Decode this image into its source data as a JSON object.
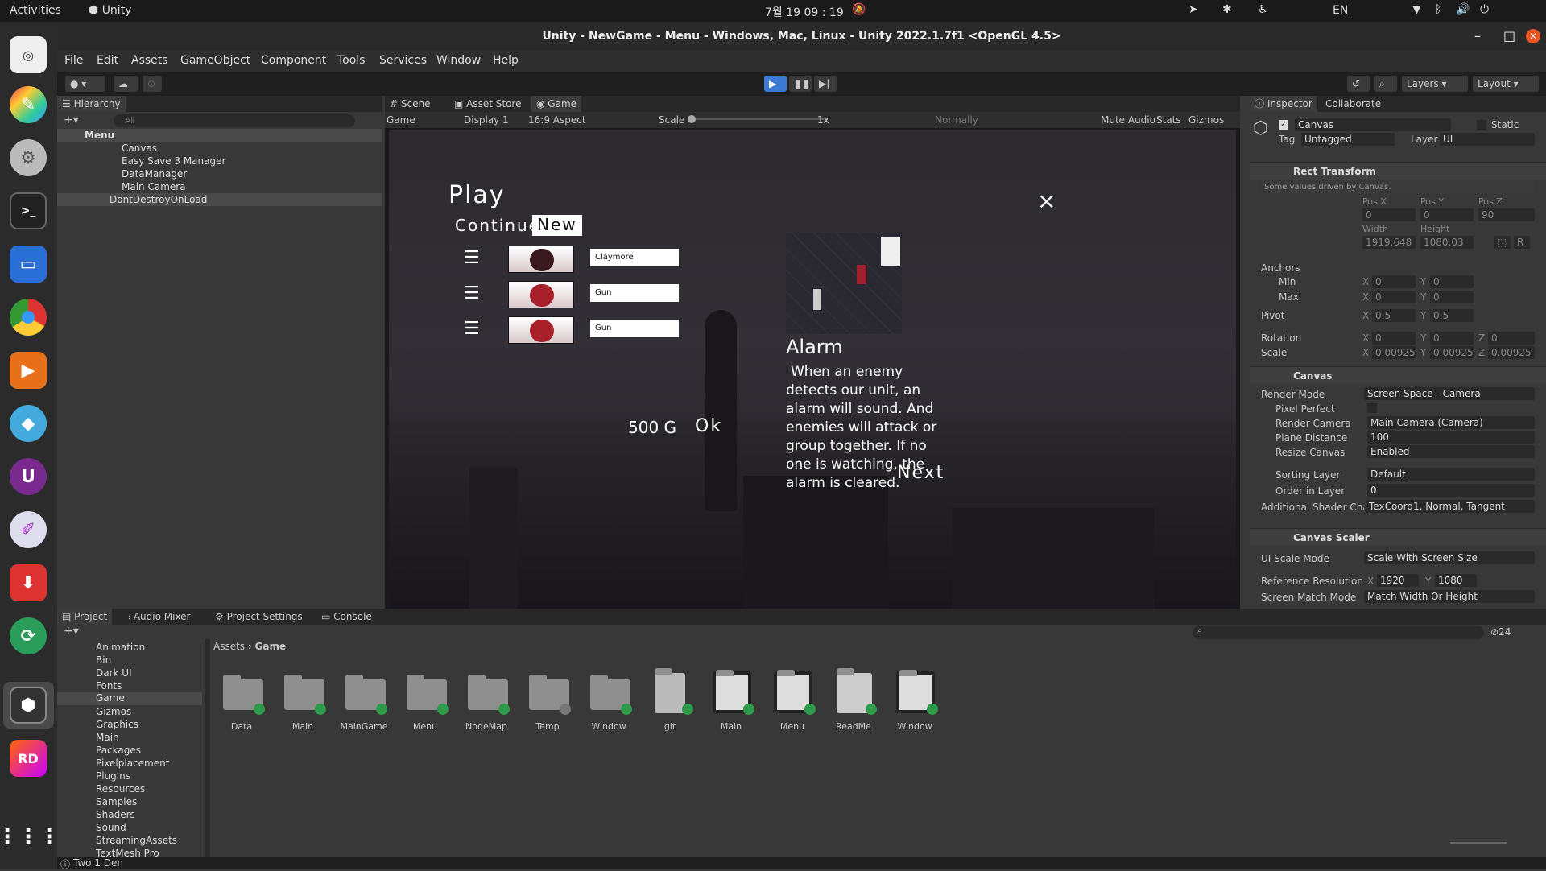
{
  "system": {
    "activities": "Activities",
    "app": "Unity",
    "clock": "7월 19  09 : 19",
    "lang": "EN"
  },
  "window": {
    "title": "Unity - NewGame - Menu - Windows, Mac, Linux - Unity 2022.1.7f1 <OpenGL 4.5>"
  },
  "menu": [
    "File",
    "Edit",
    "Assets",
    "GameObject",
    "Component",
    "Tools",
    "Services",
    "Window",
    "Help"
  ],
  "toolbar": {
    "layers": "Layers",
    "layout": "Layout"
  },
  "hierarchy": {
    "tab": "Hierarchy",
    "search_placeholder": "All",
    "items": [
      "Menu",
      "Canvas",
      "Easy Save 3 Manager",
      "DataManager",
      "Main Camera",
      "DontDestroyOnLoad"
    ]
  },
  "scene_tabs": [
    "Scene",
    "Asset Store",
    "Game"
  ],
  "gamebar": {
    "mode": "Game",
    "display": "Display 1",
    "aspect": "16:9 Aspect",
    "scale_label": "Scale",
    "scale_value": "1x",
    "normally": "Normally",
    "mute": "Mute Audio",
    "stats": "Stats",
    "gizmos": "Gizmos"
  },
  "game": {
    "play": "Play",
    "continue": "Continue",
    "new": "New",
    "slots": [
      "Claymore",
      "Gun",
      "Gun"
    ],
    "gold": "500 G",
    "ok": "Ok",
    "alarm_title": "Alarm",
    "alarm_text": "When an enemy detects our unit, an alarm will sound. And enemies will attack or group together. If no one is watching, the alarm is cleared.",
    "next": "Next",
    "close": "×"
  },
  "inspector": {
    "tabs": [
      "Inspector",
      "Collaborate"
    ],
    "name": "Canvas",
    "static": "Static",
    "tag_label": "Tag",
    "tag": "Untagged",
    "layer_label": "Layer",
    "layer": "UI",
    "rect": {
      "title": "Rect Transform",
      "note": "Some values driven by Canvas.",
      "posx_l": "Pos X",
      "posy_l": "Pos Y",
      "posz_l": "Pos Z",
      "posx": "0",
      "posy": "0",
      "posz": "90",
      "w_l": "Width",
      "h_l": "Height",
      "w": "1919.648",
      "h": "1080.03",
      "anchors": "Anchors",
      "min": "Min",
      "max": "Max",
      "pivot": "Pivot",
      "rotation": "Rotation",
      "scale": "Scale",
      "zero": "0",
      "half": "0.5",
      "sc": "0.00925",
      "x": "X",
      "y": "Y",
      "z": "Z",
      "r": "R"
    },
    "canvas": {
      "title": "Canvas",
      "render_mode_l": "Render Mode",
      "render_mode": "Screen Space - Camera",
      "pixel_perfect": "Pixel Perfect",
      "render_cam_l": "Render Camera",
      "render_cam": "Main Camera (Camera)",
      "plane_l": "Plane Distance",
      "plane": "100",
      "resize_l": "Resize Canvas",
      "resize": "Enabled",
      "sorting_l": "Sorting Layer",
      "sorting": "Default",
      "order_l": "Order in Layer",
      "order": "0",
      "shader_l": "Additional Shader Chai",
      "shader": "TexCoord1, Normal, Tangent"
    },
    "scaler": {
      "title": "Canvas Scaler",
      "mode_l": "UI Scale Mode",
      "mode": "Scale With Screen Size",
      "ref_l": "Reference Resolution",
      "rx": "1920",
      "ry": "1080",
      "match_l": "Screen Match Mode",
      "match": "Match Width Or Height"
    }
  },
  "project": {
    "tabs": [
      "Project",
      "Audio Mixer",
      "Project Settings",
      "Console"
    ],
    "tree": [
      "Animation",
      "Bin",
      "Dark UI",
      "Fonts",
      "Game",
      "Gizmos",
      "Graphics",
      "Main",
      "Packages",
      "Pixelplacement",
      "Plugins",
      "Resources",
      "Samples",
      "Shaders",
      "Sound",
      "StreamingAssets",
      "TextMesh Pro"
    ],
    "breadcrumb": [
      "Assets",
      "Game"
    ],
    "assets": [
      {
        "name": "Data",
        "kind": "folder"
      },
      {
        "name": "Main",
        "kind": "folder"
      },
      {
        "name": "MainGame",
        "kind": "folder"
      },
      {
        "name": "Menu",
        "kind": "folder"
      },
      {
        "name": "NodeMap",
        "kind": "folder"
      },
      {
        "name": "Temp",
        "kind": "folder"
      },
      {
        "name": "Window",
        "kind": "folder"
      },
      {
        "name": "git",
        "kind": "file"
      },
      {
        "name": "Main",
        "kind": "unity"
      },
      {
        "name": "Menu",
        "kind": "unity"
      },
      {
        "name": "ReadMe",
        "kind": "doc"
      },
      {
        "name": "Window",
        "kind": "unity"
      }
    ],
    "count": "24"
  },
  "status": {
    "text": "Two 1 Den"
  }
}
